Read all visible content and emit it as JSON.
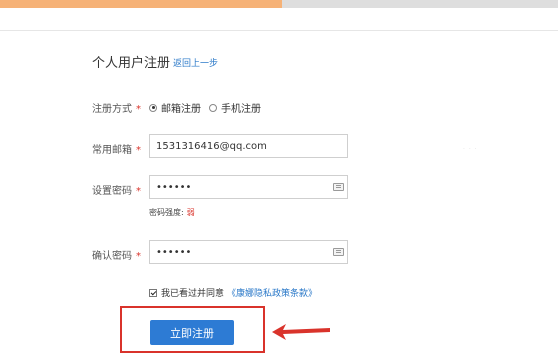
{
  "steps": [
    {
      "color": "#f6b277",
      "active": false
    },
    {
      "color": "#f6b277",
      "active": true
    },
    {
      "color": "#dedede",
      "active": false
    },
    {
      "color": "#dedede",
      "active": false
    }
  ],
  "header": {
    "title": "个人用户注册",
    "back_link": "返回上一步"
  },
  "form": {
    "method_label": "注册方式",
    "method_options": [
      {
        "label": "邮箱注册",
        "checked": true
      },
      {
        "label": "手机注册",
        "checked": false
      }
    ],
    "email_label": "常用邮箱",
    "email_value": "1531316416@qq.com",
    "password_label": "设置密码",
    "password_value": "123456",
    "strength_label": "密码强度:",
    "strength_value": "弱",
    "confirm_label": "确认密码",
    "confirm_value": "123456",
    "required_mark": "*"
  },
  "agreement": {
    "text": "我已看过并同意",
    "link": "《康娜隐私政策条款》",
    "checked": true
  },
  "submit_label": "立即注册",
  "colors": {
    "accent": "#2d7bd4",
    "highlight": "#d9332b",
    "link": "#2a78c8"
  }
}
